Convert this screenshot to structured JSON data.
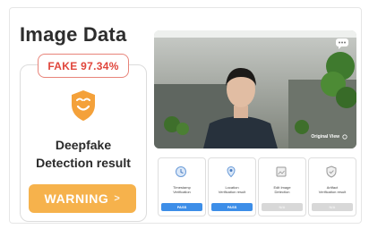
{
  "title": "Image Data",
  "result": {
    "fake_label": "FAKE 97.34%",
    "detection_line1": "Deepfake",
    "detection_line2": "Detection result",
    "warning_label": "WARNING",
    "warning_arrow": ">"
  },
  "video": {
    "original_view_label": "Original View",
    "chat_icon": "chat-bubble-icon"
  },
  "verifications": [
    {
      "line1": "Timestamp",
      "line2": "Verification",
      "status": "PASS",
      "icon": "clock-icon"
    },
    {
      "line1": "Location",
      "line2": "Verification result",
      "status": "PASS",
      "icon": "location-pin-icon"
    },
    {
      "line1": "Edit Image",
      "line2": "Detection",
      "status": "N/A",
      "icon": "edit-image-icon"
    },
    {
      "line1": "Artifact",
      "line2": "Verification result",
      "status": "N/A",
      "icon": "shield-check-icon"
    }
  ],
  "colors": {
    "warning": "#f6b24c",
    "fake_red": "#e0463c",
    "pass_blue": "#3d8ee8",
    "shield_orange": "#f4a13a"
  }
}
